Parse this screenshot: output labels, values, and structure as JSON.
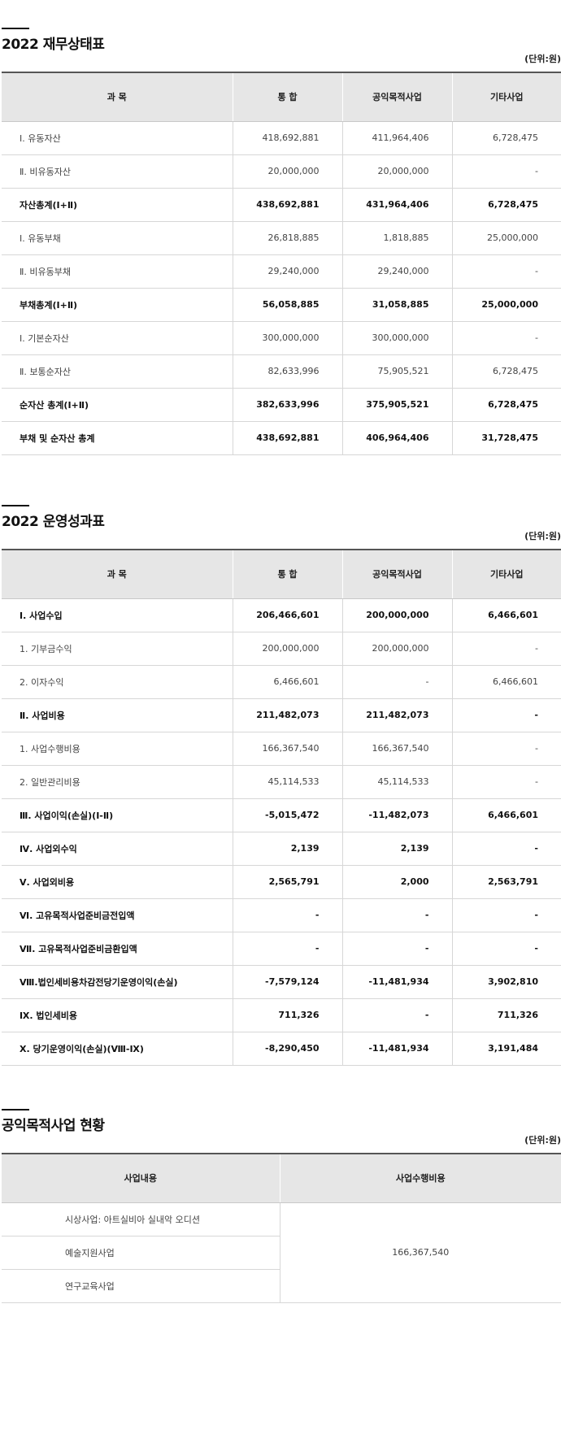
{
  "balance_sheet": {
    "title": "2022 재무상태표",
    "unit": "(단위:원)",
    "headers": [
      "과 목",
      "통 합",
      "공익목적사업",
      "기타사업"
    ],
    "rows": [
      {
        "label": "Ⅰ. 유동자산",
        "total": "418,692,881",
        "public": "411,964,406",
        "other": "6,728,475",
        "bold": false
      },
      {
        "label": "Ⅱ. 비유동자산",
        "total": "20,000,000",
        "public": "20,000,000",
        "other": "-",
        "bold": false
      },
      {
        "label": "자산총계(Ⅰ+Ⅱ)",
        "total": "438,692,881",
        "public": "431,964,406",
        "other": "6,728,475",
        "bold": true
      },
      {
        "label": "Ⅰ. 유동부채",
        "total": "26,818,885",
        "public": "1,818,885",
        "other": "25,000,000",
        "bold": false
      },
      {
        "label": "Ⅱ. 비유동부채",
        "total": "29,240,000",
        "public": "29,240,000",
        "other": "-",
        "bold": false
      },
      {
        "label": "부채총계(Ⅰ+Ⅱ)",
        "total": "56,058,885",
        "public": "31,058,885",
        "other": "25,000,000",
        "bold": true
      },
      {
        "label": "Ⅰ. 기본순자산",
        "total": "300,000,000",
        "public": "300,000,000",
        "other": "-",
        "bold": false
      },
      {
        "label": "Ⅱ. 보통순자산",
        "total": "82,633,996",
        "public": "75,905,521",
        "other": "6,728,475",
        "bold": false
      },
      {
        "label": "순자산 총계(Ⅰ+Ⅱ)",
        "total": "382,633,996",
        "public": "375,905,521",
        "other": "6,728,475",
        "bold": true
      },
      {
        "label": "부채 및 순자산 총계",
        "total": "438,692,881",
        "public": "406,964,406",
        "other": "31,728,475",
        "bold": true
      }
    ]
  },
  "income_statement": {
    "title": "2022 운영성과표",
    "unit": "(단위:원)",
    "headers": [
      "과 목",
      "통 합",
      "공익목적사업",
      "기타사업"
    ],
    "rows": [
      {
        "label": "Ⅰ. 사업수입",
        "total": "206,466,601",
        "public": "200,000,000",
        "other": "6,466,601",
        "bold": true
      },
      {
        "label": "1. 기부금수익",
        "total": "200,000,000",
        "public": "200,000,000",
        "other": "-",
        "bold": false
      },
      {
        "label": "2. 이자수익",
        "total": "6,466,601",
        "public": "-",
        "other": "6,466,601",
        "bold": false
      },
      {
        "label": "Ⅱ. 사업비용",
        "total": "211,482,073",
        "public": "211,482,073",
        "other": "-",
        "bold": true
      },
      {
        "label": "1. 사업수행비용",
        "total": "166,367,540",
        "public": "166,367,540",
        "other": "-",
        "bold": false
      },
      {
        "label": "2. 일반관리비용",
        "total": "45,114,533",
        "public": "45,114,533",
        "other": "-",
        "bold": false
      },
      {
        "label": "Ⅲ. 사업이익(손실)(Ⅰ-Ⅱ)",
        "total": "-5,015,472",
        "public": "-11,482,073",
        "other": "6,466,601",
        "bold": true
      },
      {
        "label": "Ⅳ. 사업외수익",
        "total": "2,139",
        "public": "2,139",
        "other": "-",
        "bold": true
      },
      {
        "label": "Ⅴ. 사업외비용",
        "total": "2,565,791",
        "public": "2,000",
        "other": "2,563,791",
        "bold": true
      },
      {
        "label": "Ⅵ. 고유목적사업준비금전입액",
        "total": "-",
        "public": "-",
        "other": "-",
        "bold": true
      },
      {
        "label": "Ⅶ. 고유목적사업준비금환입액",
        "total": "-",
        "public": "-",
        "other": "-",
        "bold": true
      },
      {
        "label": "Ⅷ.법인세비용차감전당기운영이익(손실)",
        "total": "-7,579,124",
        "public": "-11,481,934",
        "other": "3,902,810",
        "bold": true
      },
      {
        "label": "Ⅸ. 법인세비용",
        "total": "711,326",
        "public": "-",
        "other": "711,326",
        "bold": true
      },
      {
        "label": "Ⅹ. 당기운영이익(손실)(Ⅷ-Ⅸ)",
        "total": "-8,290,450",
        "public": "-11,481,934",
        "other": "3,191,484",
        "bold": true
      }
    ]
  },
  "public_projects": {
    "title": "공익목적사업 현황",
    "unit": "(단위:원)",
    "headers": [
      "사업내용",
      "사업수행비용"
    ],
    "items": [
      "시상사업: 아트실비아 실내악 오디션",
      "예술지원사업",
      "연구교육사업"
    ],
    "cost": "166,367,540"
  }
}
